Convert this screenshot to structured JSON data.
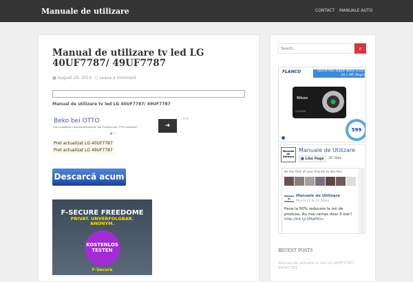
{
  "header": {
    "site_title": "Manuale de utilizare",
    "nav": [
      "CONTACT",
      "MANUALE AUTO"
    ]
  },
  "post": {
    "title": "Manual de utilizare tv led LG 40UF7787/ 49UF7787",
    "date": "August 29, 2015",
    "comment_link": "Leave a comment",
    "subtitle": "Manual de utilizare tv led LG 40UF7787/ 49UF7787",
    "ad": {
      "headline": "Beko bei OTTO",
      "text": "Hier entstehen Heimwerkerträume: Top Produkte bei OTTO bestellen!"
    },
    "price_links": [
      "Pret actualizat LG 40UF7787",
      "Pret actualizat LG 49UF7787"
    ],
    "download_label": "Descarcă acum",
    "banner": {
      "title": "F-SECURE FREEDOME",
      "tagline": "PRIVAT. UNVERFOLGBAR. ANONYM.",
      "cta": "KOSTENLOS TESTEN",
      "brand": "F-Secure"
    }
  },
  "sidebar": {
    "search_placeholder": "Search...",
    "flanco": {
      "brand": "FLANCO",
      "product": "Aparat foto digital Nikon A100, 20.1 MP, Negru",
      "price": "599",
      "camera_brand": "Nikon",
      "camera_model": "COOLPIX"
    },
    "facebook": {
      "page_logo": "Manuale de Utilizare",
      "page_name": "Manuale de Utilizare",
      "like_label": "Like Page",
      "likes": "2K likes",
      "friends_text": "Be the first of your friends to like this",
      "post_author": "Manuale de Utilizare",
      "post_time": "March 17 at 11:50am ·",
      "post_text": "Pana la 50% reducere la mii de produse. Au mai ramas doar 3 ore!!",
      "post_link": "http://bit.ly/1MpEKtn"
    },
    "recent_posts_title": "RECENT POSTS",
    "recent_posts": [
      "Manual de utilizare tv led LG 40UF7787/ 49UF7787"
    ]
  }
}
